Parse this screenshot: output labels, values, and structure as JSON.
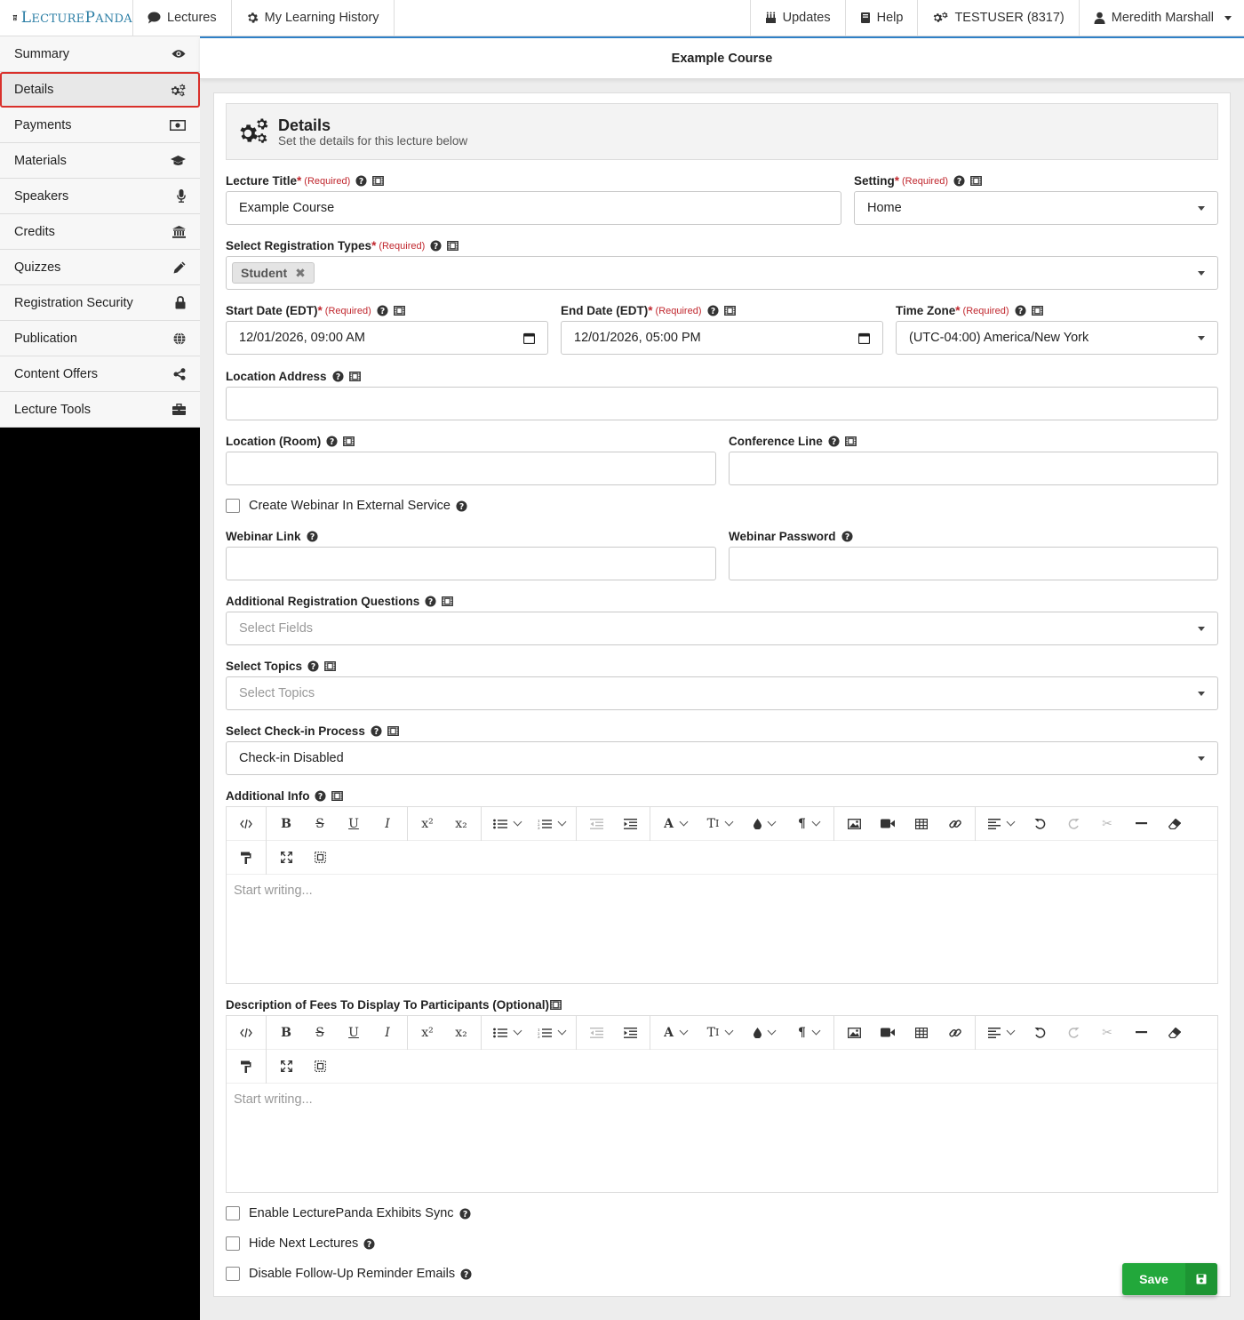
{
  "brand": {
    "name_big": "L",
    "name_rest": "ECTURE",
    "name_big2": "P",
    "name_rest2": "ANDA"
  },
  "topnav": {
    "lectures": "Lectures",
    "history": "My Learning History",
    "updates": "Updates",
    "help": "Help",
    "org": "TESTUSER (8317)",
    "user": "Meredith Marshall"
  },
  "sidebar": {
    "items": [
      {
        "label": "Summary",
        "icon": "eye-icon"
      },
      {
        "label": "Details",
        "icon": "gears-icon"
      },
      {
        "label": "Payments",
        "icon": "money-icon"
      },
      {
        "label": "Materials",
        "icon": "graduation-cap-icon"
      },
      {
        "label": "Speakers",
        "icon": "microphone-icon"
      },
      {
        "label": "Credits",
        "icon": "institution-icon"
      },
      {
        "label": "Quizzes",
        "icon": "pencil-icon"
      },
      {
        "label": "Registration Security",
        "icon": "lock-icon"
      },
      {
        "label": "Publication",
        "icon": "globe-icon"
      },
      {
        "label": "Content Offers",
        "icon": "share-icon"
      },
      {
        "label": "Lecture Tools",
        "icon": "briefcase-icon"
      }
    ]
  },
  "page": {
    "course_title": "Example Course",
    "section_title": "Details",
    "section_subtitle": "Set the details for this lecture below"
  },
  "form": {
    "required_mark": "*",
    "required_text": "(Required)",
    "lecture_title": {
      "label": "Lecture Title",
      "value": "Example Course"
    },
    "setting": {
      "label": "Setting",
      "value": "Home"
    },
    "registration_types": {
      "label": "Select Registration Types",
      "chip": "Student"
    },
    "start_date": {
      "label": "Start Date (EDT)",
      "value": "12/01/2026, 09:00 AM"
    },
    "end_date": {
      "label": "End Date (EDT)",
      "value": "12/01/2026, 05:00 PM"
    },
    "time_zone": {
      "label": "Time Zone",
      "value": "(UTC-04:00) America/New York"
    },
    "location_address": {
      "label": "Location Address",
      "value": ""
    },
    "location_room": {
      "label": "Location (Room)",
      "value": ""
    },
    "conference_line": {
      "label": "Conference Line",
      "value": ""
    },
    "create_webinar": {
      "label": "Create Webinar In External Service",
      "checked": false
    },
    "webinar_link": {
      "label": "Webinar Link",
      "value": ""
    },
    "webinar_password": {
      "label": "Webinar Password",
      "value": ""
    },
    "additional_questions": {
      "label": "Additional Registration Questions",
      "placeholder": "Select Fields"
    },
    "topics": {
      "label": "Select Topics",
      "placeholder": "Select Topics"
    },
    "checkin": {
      "label": "Select Check-in Process",
      "value": "Check-in Disabled"
    },
    "additional_info": {
      "label": "Additional Info",
      "placeholder": "Start writing..."
    },
    "fees_description": {
      "label": "Description of Fees To Display To Participants (Optional)",
      "placeholder": "Start writing..."
    },
    "exhibits_sync": {
      "label": "Enable LecturePanda Exhibits Sync",
      "checked": false
    },
    "hide_next": {
      "label": "Hide Next Lectures",
      "checked": false
    },
    "disable_followup": {
      "label": "Disable Follow-Up Reminder Emails",
      "checked": false
    }
  },
  "buttons": {
    "save": "Save"
  },
  "colors": {
    "accent_blue": "#2f80c6",
    "required_red": "#c0262d",
    "save_green": "#22a83b",
    "active_outline": "#d9302b"
  }
}
